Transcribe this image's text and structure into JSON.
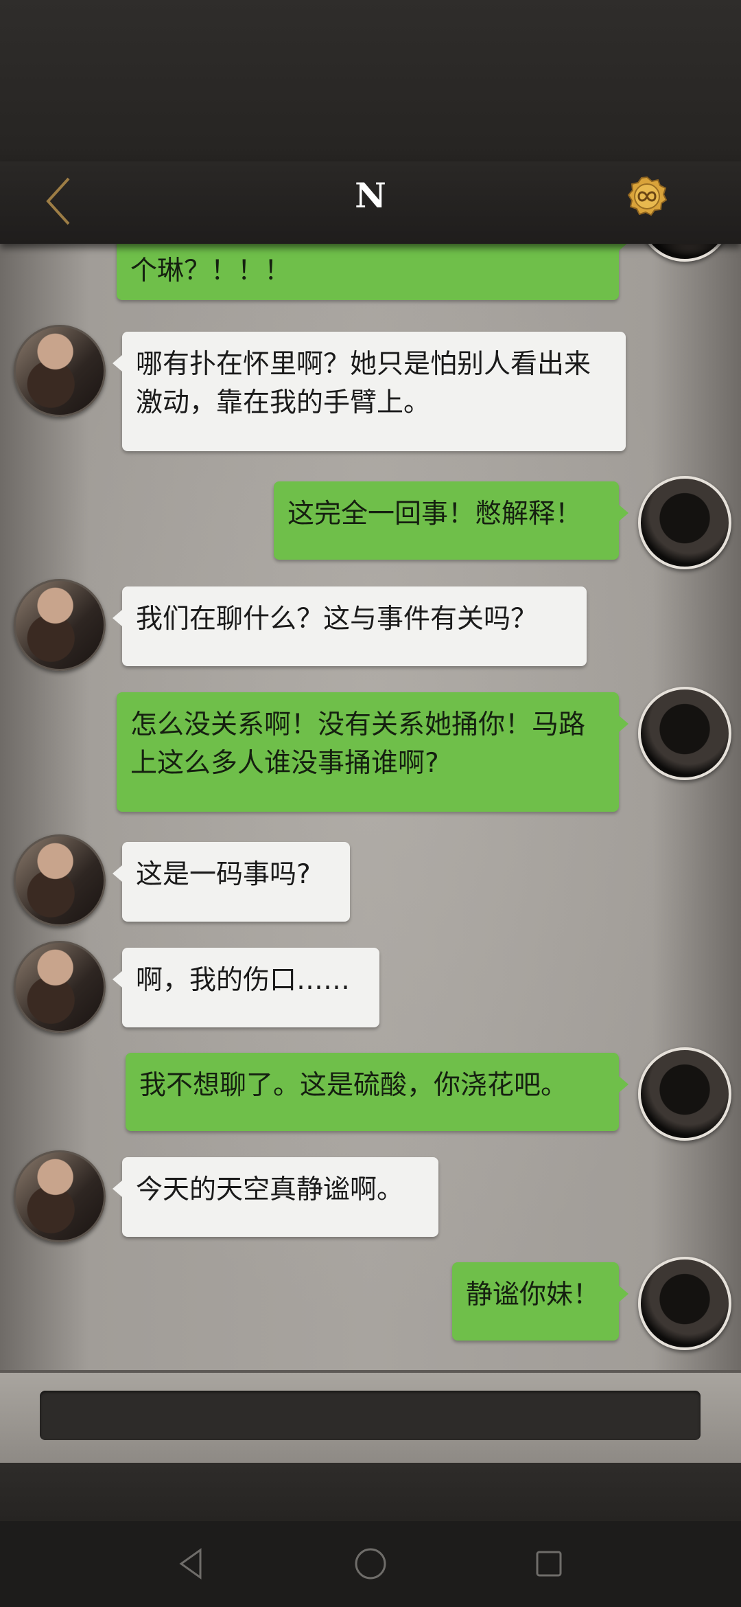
{
  "header": {
    "title": "N",
    "back_icon": "chevron-left-icon",
    "coin_icon": "gold-infinity-coin-icon"
  },
  "messages": [
    {
      "from": "me",
      "text": "个琳？！！！"
    },
    {
      "from": "them",
      "text": "哪有扑在怀里啊？她只是怕别人看出来激动，靠在我的手臂上。"
    },
    {
      "from": "me",
      "text": "这完全一回事！憋解释！"
    },
    {
      "from": "them",
      "text": "我们在聊什么？这与事件有关吗？"
    },
    {
      "from": "me",
      "text": "怎么没关系啊！没有关系她捅你！马路上这么多人谁没事捅谁啊?"
    },
    {
      "from": "them",
      "text": "这是一码事吗?"
    },
    {
      "from": "them",
      "text": "啊，我的伤口……"
    },
    {
      "from": "me",
      "text": "我不想聊了。这是硫酸，你浇花吧。"
    },
    {
      "from": "them",
      "text": "今天的天空真静谧啊。"
    },
    {
      "from": "me",
      "text": "静谧你妹！"
    }
  ],
  "input": {
    "placeholder": ""
  },
  "colors": {
    "outgoing_bubble": "#6fbf4a",
    "incoming_bubble": "#f2f2f0",
    "coin": "#d9a33a"
  },
  "nav": [
    "back-triangle-icon",
    "home-circle-icon",
    "recents-square-icon"
  ]
}
